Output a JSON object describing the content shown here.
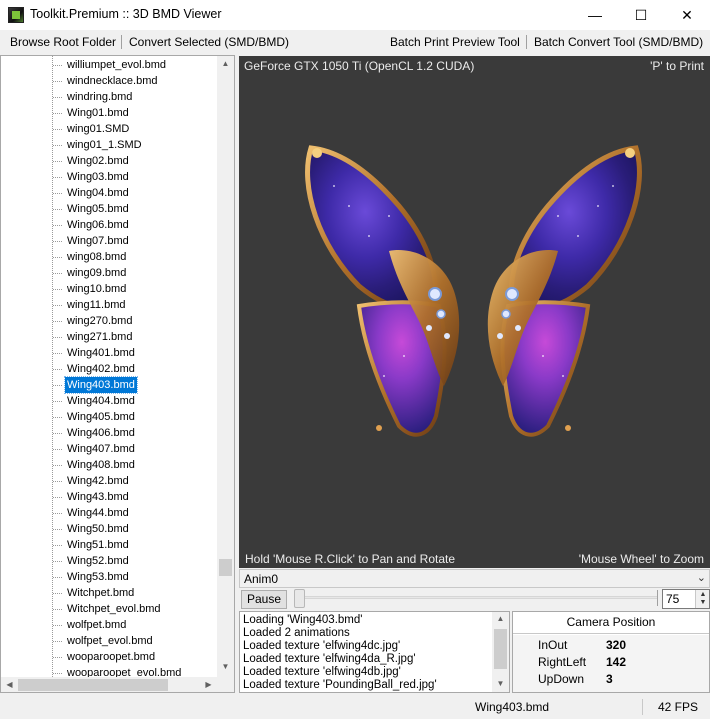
{
  "window": {
    "title": "Toolkit.Premium :: 3D BMD Viewer",
    "controls": {
      "minimize": "—",
      "maximize": "☐",
      "close": "✕"
    }
  },
  "toolbar": {
    "browse_root": "Browse Root Folder",
    "convert_selected": "Convert Selected (SMD/BMD)",
    "batch_print_preview": "Batch Print Preview Tool",
    "batch_convert": "Batch Convert Tool (SMD/BMD)"
  },
  "tree": {
    "items": [
      "williumpet_evol.bmd",
      "windnecklace.bmd",
      "windring.bmd",
      "Wing01.bmd",
      "wing01.SMD",
      "wing01_1.SMD",
      "Wing02.bmd",
      "Wing03.bmd",
      "Wing04.bmd",
      "Wing05.bmd",
      "Wing06.bmd",
      "Wing07.bmd",
      "wing08.bmd",
      "wing09.bmd",
      "wing10.bmd",
      "wing11.bmd",
      "wing270.bmd",
      "wing271.bmd",
      "Wing401.bmd",
      "Wing402.bmd",
      "Wing403.bmd",
      "Wing404.bmd",
      "Wing405.bmd",
      "Wing406.bmd",
      "Wing407.bmd",
      "Wing408.bmd",
      "Wing42.bmd",
      "Wing43.bmd",
      "Wing44.bmd",
      "Wing50.bmd",
      "Wing51.bmd",
      "Wing52.bmd",
      "Wing53.bmd",
      "Witchpet.bmd",
      "Witchpet_evol.bmd",
      "wolfpet.bmd",
      "wolfpet_evol.bmd",
      "wooparoopet.bmd",
      "wooparoopet_evol.bmd"
    ],
    "selected_index": 20,
    "scroll_up": "▲",
    "scroll_down": "▼",
    "scroll_left": "◀",
    "scroll_right": "▶"
  },
  "viewport": {
    "gpu_info": "GeForce GTX 1050 Ti (OpenCL 1.2 CUDA)",
    "print_hint": "'P' to Print",
    "pan_hint": "Hold 'Mouse R.Click' to Pan and Rotate",
    "zoom_hint": "'Mouse Wheel' to Zoom",
    "background": "#3a3a3a"
  },
  "animation": {
    "selected": "Anim0",
    "dropdown_icon": "chevron-down-icon",
    "pause_label": "Pause",
    "frame_progress": 0,
    "speed_value": "75"
  },
  "log": {
    "lines": [
      "Loading 'Wing403.bmd'",
      "Loaded 2 animations",
      "Loaded texture 'elfwing4dc.jpg'",
      "Loaded texture 'elfwing4da_R.jpg'",
      "Loaded texture 'elfwing4db.jpg'",
      "Loaded texture 'PoundingBall_red.jpg'"
    ]
  },
  "camera": {
    "title": "Camera Position",
    "rows": [
      {
        "label": "InOut",
        "value": "320"
      },
      {
        "label": "RightLeft",
        "value": "142"
      },
      {
        "label": "UpDown",
        "value": "3"
      }
    ]
  },
  "status": {
    "file": "Wing403.bmd",
    "fps": "42 FPS"
  },
  "colors": {
    "selection": "#0078d7",
    "wing_purple": "#4a2fb0",
    "wing_magenta": "#b03cc8",
    "wing_gold": "#c88a3a"
  }
}
